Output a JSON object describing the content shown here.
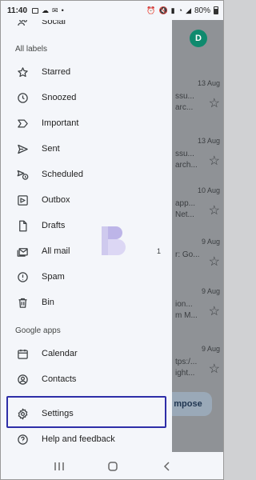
{
  "status_bar": {
    "time": "11:40",
    "battery": "80%"
  },
  "inbox_background": {
    "avatar_letter": "D",
    "compose_label": "mpose",
    "rows": [
      {
        "date": "13 Aug",
        "line1": "ssu...",
        "line2": "arc..."
      },
      {
        "date": "13 Aug",
        "line1": "ssu...",
        "line2": "arch..."
      },
      {
        "date": "10 Aug",
        "line1": "app...",
        "line2": "Net..."
      },
      {
        "date": "9 Aug",
        "line1": "r: Go...",
        "line2": ""
      },
      {
        "date": "9 Aug",
        "line1": "ion...",
        "line2": "m M..."
      },
      {
        "date": "9 Aug",
        "line1": "tps:/...",
        "line2": "ight..."
      }
    ]
  },
  "drawer": {
    "top_item": "Social",
    "labels_header": "All labels",
    "items": [
      {
        "label": "Starred",
        "icon": "star-icon"
      },
      {
        "label": "Snoozed",
        "icon": "clock-icon"
      },
      {
        "label": "Important",
        "icon": "important-icon"
      },
      {
        "label": "Sent",
        "icon": "send-icon"
      },
      {
        "label": "Scheduled",
        "icon": "scheduled-icon"
      },
      {
        "label": "Outbox",
        "icon": "outbox-icon"
      },
      {
        "label": "Drafts",
        "icon": "draft-icon"
      },
      {
        "label": "All mail",
        "icon": "all-mail-icon",
        "count": "1"
      },
      {
        "label": "Spam",
        "icon": "spam-icon"
      },
      {
        "label": "Bin",
        "icon": "bin-icon"
      }
    ],
    "apps_header": "Google apps",
    "apps": [
      {
        "label": "Calendar",
        "icon": "calendar-icon"
      },
      {
        "label": "Contacts",
        "icon": "contacts-icon"
      }
    ],
    "settings": {
      "label": "Settings",
      "icon": "gear-icon"
    },
    "help": {
      "label": "Help and feedback",
      "icon": "help-icon"
    }
  },
  "colors": {
    "drawer_bg": "#f4f6fa",
    "highlight_border": "#2e2ea8",
    "dim_overlay": "#8f9296"
  }
}
